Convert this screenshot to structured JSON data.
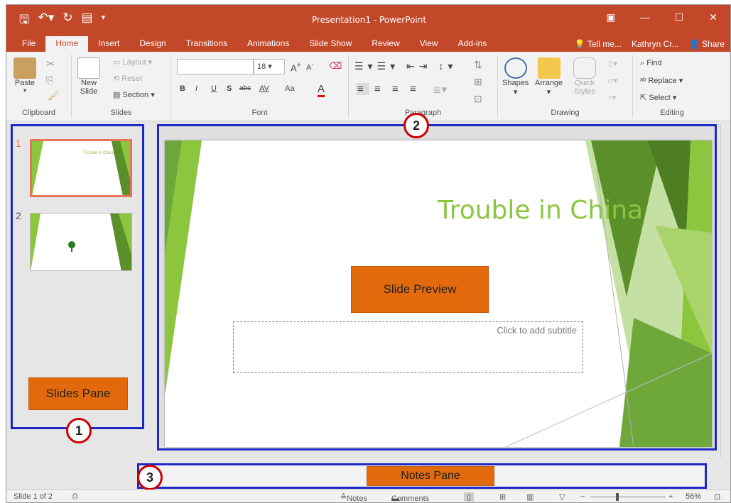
{
  "window": {
    "title": "Presentation1 - PowerPoint",
    "qat_icons": [
      "save-icon",
      "undo-icon",
      "redo-icon",
      "start-slideshow-icon",
      "customize-qat-icon"
    ],
    "controls": [
      "▣",
      "—",
      "☐",
      "✕"
    ]
  },
  "tabs": {
    "items": [
      "File",
      "Home",
      "Insert",
      "Design",
      "Transitions",
      "Animations",
      "Slide Show",
      "Review",
      "View",
      "Add-ins"
    ],
    "active": "Home",
    "tell_me": "Tell me...",
    "user": "Kathryn Cr...",
    "share": "Share"
  },
  "ribbon": {
    "clipboard": {
      "paste": "Paste",
      "label": "Clipboard"
    },
    "slides": {
      "new_slide": "New",
      "new_slide2": "Slide",
      "layout": "Layout",
      "reset": "Reset",
      "section": "Section",
      "label": "Slides"
    },
    "font": {
      "size": "18",
      "label": "Font",
      "bold": "B",
      "italic": "I",
      "underline": "U",
      "shadow": "S",
      "strike": "abc",
      "spacing": "AV",
      "case": "Aa",
      "color": "A"
    },
    "paragraph": {
      "label": "Paragraph"
    },
    "drawing": {
      "shapes": "Shapes",
      "arrange": "Arrange",
      "quick": "Quick",
      "styles": "Styles",
      "label": "Drawing"
    },
    "editing": {
      "find": "Find",
      "replace": "Replace",
      "select": "Select",
      "label": "Editing"
    }
  },
  "slides_pane": {
    "thumbs": [
      {
        "num": "1",
        "title": "Trouble in China"
      },
      {
        "num": "2",
        "title": ""
      }
    ],
    "label": "Slides Pane",
    "badge": "1"
  },
  "main_slide": {
    "title": "Trouble in China",
    "subtitle_placeholder": "Click to add subtitle",
    "preview_label": "Slide Preview",
    "badge": "2"
  },
  "notes_pane": {
    "label": "Notes Pane",
    "badge": "3"
  },
  "status": {
    "slide_counter": "Slide 1 of 2",
    "notes": "Notes",
    "comments": "Comments",
    "zoom": "56%"
  },
  "colors": {
    "accent": "#c3482a",
    "highlight_border": "#1f28c7",
    "callout_orange": "#e26a0c",
    "slide_green": "#8cc63f"
  }
}
